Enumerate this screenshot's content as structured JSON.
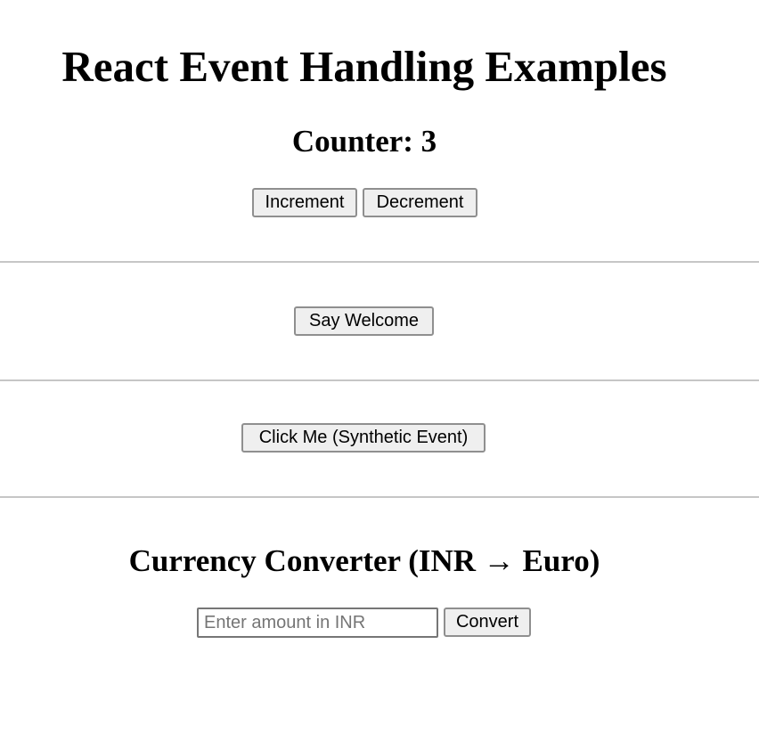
{
  "page": {
    "title": "React Event Handling Examples"
  },
  "counter": {
    "heading": "Counter: 3",
    "increment_label": "Increment",
    "decrement_label": "Decrement"
  },
  "welcome": {
    "button_label": "Say Welcome"
  },
  "synthetic": {
    "button_label": "Click Me (Synthetic Event)"
  },
  "converter": {
    "heading": "Currency Converter (INR → Euro)",
    "input_value": "",
    "input_placeholder": "Enter amount in INR",
    "convert_label": "Convert"
  },
  "colors": {
    "background": "#ffffff",
    "text": "#000000",
    "button_background": "#efefef",
    "button_border": "#8f8f8f",
    "divider": "#c6c6c6",
    "placeholder": "#757575"
  }
}
